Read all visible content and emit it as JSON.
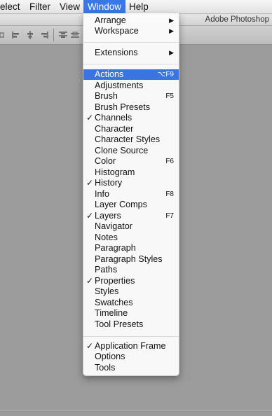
{
  "menubar": {
    "items": [
      {
        "label": "elect"
      },
      {
        "label": "Filter"
      },
      {
        "label": "View"
      },
      {
        "label": "Window"
      },
      {
        "label": "Help"
      }
    ]
  },
  "app": {
    "title": "Adobe Photoshop"
  },
  "toolbar": {
    "icons": [
      "align-top-edges-icon",
      "align-vertical-centers-icon",
      "align-bottom-edges-icon",
      "distribute-top-edges-icon",
      "distribute-vertical-centers-icon"
    ]
  },
  "window_menu": {
    "arrange": {
      "label": "Arrange",
      "arrow": "▶"
    },
    "workspace": {
      "label": "Workspace",
      "arrow": "▶"
    },
    "extensions": {
      "label": "Extensions",
      "arrow": "▶"
    },
    "check_mark": "✓",
    "items": [
      {
        "label": "Actions",
        "shortcut": "⌥F9",
        "checked": false,
        "highlighted": true
      },
      {
        "label": "Adjustments",
        "shortcut": "",
        "checked": false
      },
      {
        "label": "Brush",
        "shortcut": "F5",
        "checked": false
      },
      {
        "label": "Brush Presets",
        "shortcut": "",
        "checked": false
      },
      {
        "label": "Channels",
        "shortcut": "",
        "checked": true
      },
      {
        "label": "Character",
        "shortcut": "",
        "checked": false
      },
      {
        "label": "Character Styles",
        "shortcut": "",
        "checked": false
      },
      {
        "label": "Clone Source",
        "shortcut": "",
        "checked": false
      },
      {
        "label": "Color",
        "shortcut": "F6",
        "checked": false
      },
      {
        "label": "Histogram",
        "shortcut": "",
        "checked": false
      },
      {
        "label": "History",
        "shortcut": "",
        "checked": true
      },
      {
        "label": "Info",
        "shortcut": "F8",
        "checked": false
      },
      {
        "label": "Layer Comps",
        "shortcut": "",
        "checked": false
      },
      {
        "label": "Layers",
        "shortcut": "F7",
        "checked": true
      },
      {
        "label": "Navigator",
        "shortcut": "",
        "checked": false
      },
      {
        "label": "Notes",
        "shortcut": "",
        "checked": false
      },
      {
        "label": "Paragraph",
        "shortcut": "",
        "checked": false
      },
      {
        "label": "Paragraph Styles",
        "shortcut": "",
        "checked": false
      },
      {
        "label": "Paths",
        "shortcut": "",
        "checked": false
      },
      {
        "label": "Properties",
        "shortcut": "",
        "checked": true
      },
      {
        "label": "Styles",
        "shortcut": "",
        "checked": false
      },
      {
        "label": "Swatches",
        "shortcut": "",
        "checked": false
      },
      {
        "label": "Timeline",
        "shortcut": "",
        "checked": false
      },
      {
        "label": "Tool Presets",
        "shortcut": "",
        "checked": false
      }
    ],
    "application_frame": {
      "label": "Application Frame",
      "checked": true
    },
    "options": {
      "label": "Options",
      "checked": false
    },
    "tools": {
      "label": "Tools",
      "checked": false
    }
  },
  "colors": {
    "highlight": "#3b74e0",
    "workspace": "#9b9b9b"
  }
}
